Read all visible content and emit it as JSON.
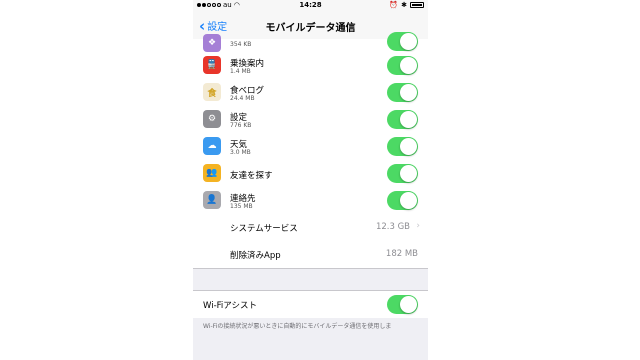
{
  "status": {
    "carrier": "au",
    "time": "14:28"
  },
  "nav": {
    "back_label": "設定",
    "title": "モバイルデータ通信"
  },
  "apps": [
    {
      "name": "",
      "size": "354 KB",
      "icon": "app-icon-purple",
      "color": "#a57fd6",
      "enabled": true
    },
    {
      "name": "乗換案内",
      "size": "1.4 MB",
      "icon": "train-icon",
      "color": "#e8352a",
      "enabled": true
    },
    {
      "name": "食べログ",
      "size": "24.4 MB",
      "icon": "tabelog-icon",
      "color": "#f3ead3",
      "enabled": true
    },
    {
      "name": "設定",
      "size": "776 KB",
      "icon": "gear-icon",
      "color": "#8e8e93",
      "enabled": true
    },
    {
      "name": "天気",
      "size": "3.0 MB",
      "icon": "weather-icon",
      "color": "#3a9af0",
      "enabled": true
    },
    {
      "name": "友達を探す",
      "size": "",
      "icon": "friends-icon",
      "color": "#f4b323",
      "enabled": true
    },
    {
      "name": "連絡先",
      "size": "135 MB",
      "icon": "contacts-icon",
      "color": "#a9a9ae",
      "enabled": true
    }
  ],
  "system_services": {
    "label": "システムサービス",
    "value": "12.3 GB"
  },
  "deleted_apps": {
    "label": "削除済みApp",
    "value": "182 MB"
  },
  "wifi_assist": {
    "label": "Wi-Fiアシスト",
    "enabled": true
  },
  "footer_text": "Wi-Fiの接続状況が悪いときに自動的にモバイルデータ通信を使用しま",
  "accent_color": "#1a82fb",
  "toggle_on_color": "#4cd964"
}
